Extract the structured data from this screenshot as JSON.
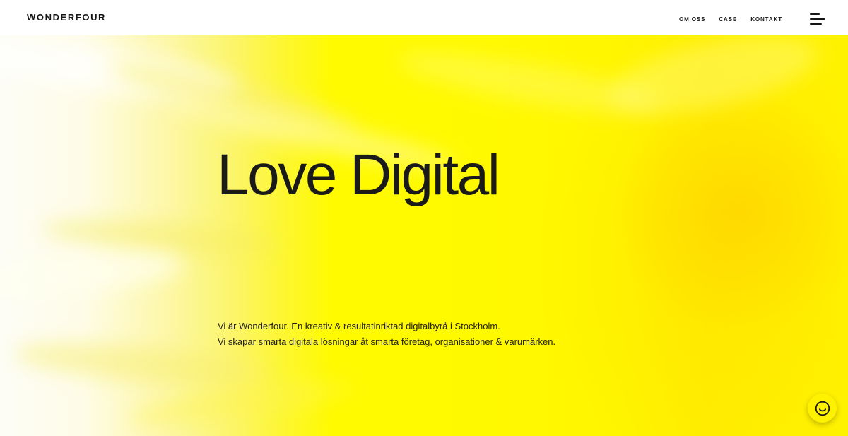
{
  "header": {
    "logo": "WONDERFOUR",
    "nav": [
      {
        "label": "OM OSS"
      },
      {
        "label": "CASE"
      },
      {
        "label": "KONTAKT"
      }
    ],
    "menu_icon": "hamburger-menu-icon"
  },
  "hero": {
    "title": "Love Digital",
    "lines": [
      "Vi är Wonderfour. En kreativ & resultatinriktad digitalbyrå i Stockholm.",
      "Vi skapar smarta digitala lösningar åt smarta företag, organisationer & varumärken."
    ],
    "colors": {
      "accent": "#FFF200",
      "text": "#1A1A1A"
    }
  },
  "chat": {
    "icon": "smiley-chat-icon"
  }
}
